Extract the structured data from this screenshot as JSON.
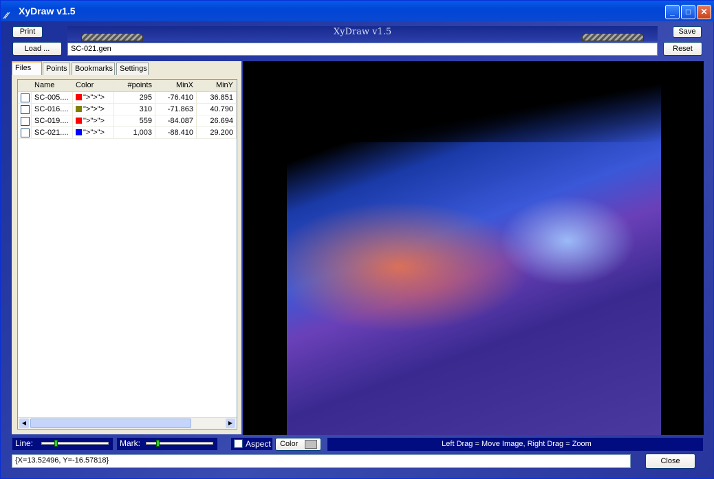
{
  "window": {
    "title": "XyDraw v1.5",
    "minimize": "_",
    "maximize": "□",
    "close": "✕"
  },
  "toolbar": {
    "print": "Print",
    "load": "Load ...",
    "file_value": "SC-021.gen",
    "banner": "XyDraw v1.5",
    "save": "Save",
    "reset": "Reset"
  },
  "tabs": [
    "Files",
    "Points",
    "Bookmarks",
    "Settings"
  ],
  "table": {
    "columns": [
      "",
      "Name",
      "Color",
      "#points",
      "MinX",
      "MinY"
    ],
    "rows": [
      {
        "name": "SC-005....",
        "color": "#ff0000",
        "points": "295",
        "minx": "-76.410",
        "miny": "36.851"
      },
      {
        "name": "SC-016....",
        "color": "#808000",
        "points": "310",
        "minx": "-71.863",
        "miny": "40.790"
      },
      {
        "name": "SC-019....",
        "color": "#ff0000",
        "points": "559",
        "minx": "-84.087",
        "miny": "26.694"
      },
      {
        "name": "SC-021....",
        "color": "#0000ff",
        "points": "1,003",
        "minx": "-88.410",
        "miny": "29.200"
      }
    ]
  },
  "bottom": {
    "line_label": "Line:",
    "mark_label": "Mark:",
    "line_level": 0.2,
    "mark_level": 0.15,
    "aspect_label": "Aspect",
    "color_label": "Color",
    "hint": "Left Drag = Move Image,   Right Drag = Zoom",
    "coords": "{X=13.52496, Y=-16.57818}",
    "close": "Close"
  }
}
